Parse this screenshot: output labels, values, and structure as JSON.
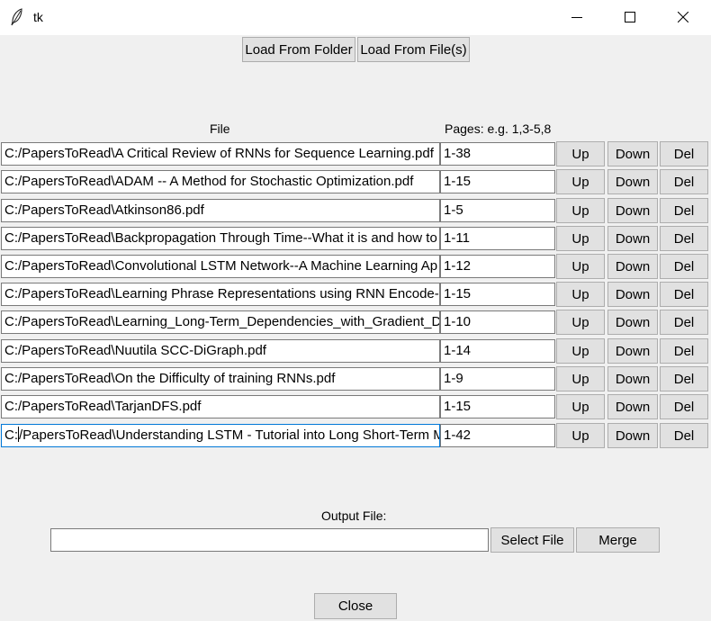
{
  "window": {
    "title": "tk",
    "icons": [
      "feather-icon",
      "minimize-icon",
      "maximize-icon",
      "close-icon"
    ]
  },
  "toolbar": {
    "load_folder_label": "Load From Folder",
    "load_files_label": "Load From File(s)"
  },
  "headers": {
    "file": "File",
    "pages": "Pages: e.g. 1,3-5,8"
  },
  "rows": [
    {
      "file": "C:/PapersToRead\\A Critical Review of RNNs for Sequence Learning.pdf",
      "pages": "1-38"
    },
    {
      "file": "C:/PapersToRead\\ADAM -- A Method for Stochastic Optimization.pdf",
      "pages": "1-15"
    },
    {
      "file": "C:/PapersToRead\\Atkinson86.pdf",
      "pages": "1-5"
    },
    {
      "file": "C:/PapersToRead\\Backpropagation Through Time--What it is and how to",
      "pages": "1-11"
    },
    {
      "file": "C:/PapersToRead\\Convolutional LSTM Network--A Machine Learning Ap",
      "pages": "1-12"
    },
    {
      "file": "C:/PapersToRead\\Learning Phrase Representations using RNN Encode-De",
      "pages": "1-15"
    },
    {
      "file": "C:/PapersToRead\\Learning_Long-Term_Dependencies_with_Gradient_Des",
      "pages": "1-10"
    },
    {
      "file": "C:/PapersToRead\\Nuutila SCC-DiGraph.pdf",
      "pages": "1-14"
    },
    {
      "file": "C:/PapersToRead\\On the Difficulty of training RNNs.pdf",
      "pages": "1-9"
    },
    {
      "file": "C:/PapersToRead\\TarjanDFS.pdf",
      "pages": "1-15"
    },
    {
      "file_before_caret": "C:",
      "file": "/PapersToRead\\Understanding LSTM - Tutorial into Long Short-Term M",
      "pages": "1-42"
    }
  ],
  "row_buttons": {
    "up": "Up",
    "down": "Down",
    "del": "Del"
  },
  "output": {
    "label": "Output File:",
    "value": "",
    "select_label": "Select File",
    "merge_label": "Merge"
  },
  "close_label": "Close"
}
